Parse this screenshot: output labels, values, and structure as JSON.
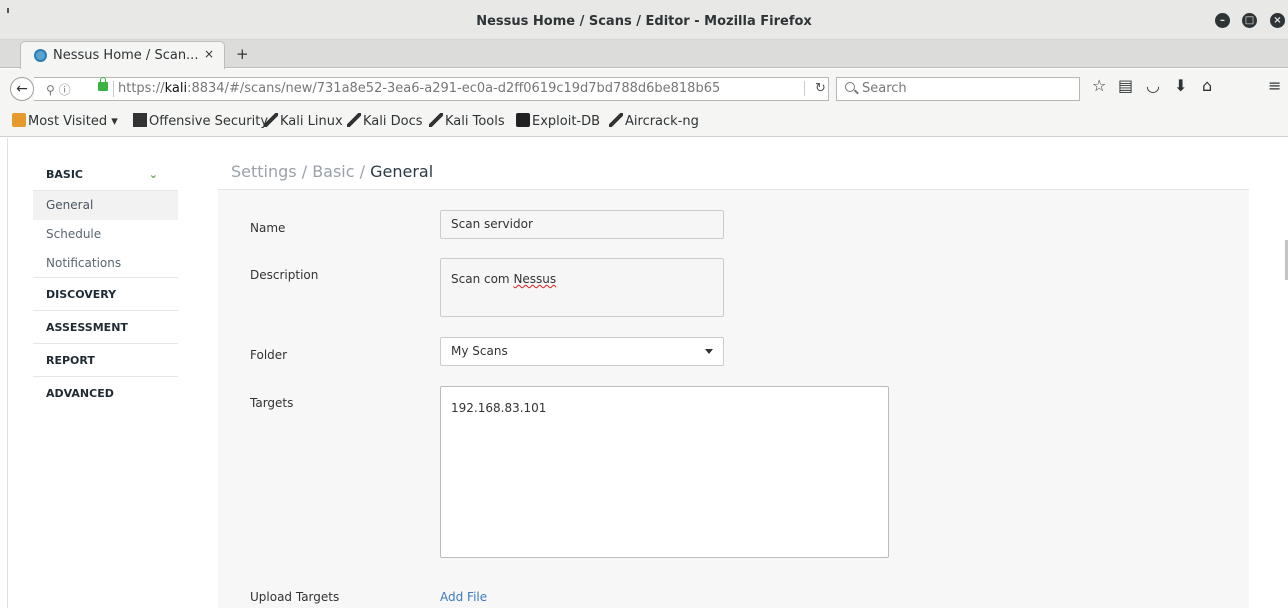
{
  "window": {
    "title": "Nessus Home / Scans / Editor - Mozilla Firefox"
  },
  "tab": {
    "label": "Nessus Home / Scan...",
    "close": "×",
    "new_tab": "+"
  },
  "navbar": {
    "url_prefix": "https://",
    "url_host": "kali",
    "url_rest": ":8834/#/scans/new/731a8e52-3ea6-a291-ec0a-d2ff0619c19d7bd788d6be818b65",
    "search_placeholder": "Search"
  },
  "bookmarks": [
    {
      "label": "Most Visited ▾",
      "icon": "folder-icon"
    },
    {
      "label": "Offensive Security",
      "icon": "offsec-icon"
    },
    {
      "label": "Kali Linux",
      "icon": "kali-icon"
    },
    {
      "label": "Kali Docs",
      "icon": "kali-icon"
    },
    {
      "label": "Kali Tools",
      "icon": "kali-icon"
    },
    {
      "label": "Exploit-DB",
      "icon": "exploitdb-icon"
    },
    {
      "label": "Aircrack-ng",
      "icon": "aircrack-icon"
    }
  ],
  "sidebar": {
    "basic": "BASIC",
    "items": [
      "General",
      "Schedule",
      "Notifications"
    ],
    "sections": [
      "DISCOVERY",
      "ASSESSMENT",
      "REPORT",
      "ADVANCED"
    ]
  },
  "breadcrumb": {
    "prefix": "Settings / Basic / ",
    "current": "General"
  },
  "form": {
    "name_label": "Name",
    "name_value": "Scan servidor",
    "description_label": "Description",
    "description_value_a": "Scan com ",
    "description_value_b": "Nessus",
    "folder_label": "Folder",
    "folder_value": "My Scans",
    "targets_label": "Targets",
    "targets_value": "192.168.83.101",
    "upload_label": "Upload Targets",
    "add_file": "Add File"
  },
  "colors": {
    "accent_link": "#3b7bbf",
    "chevron_green": "#5aa645"
  }
}
